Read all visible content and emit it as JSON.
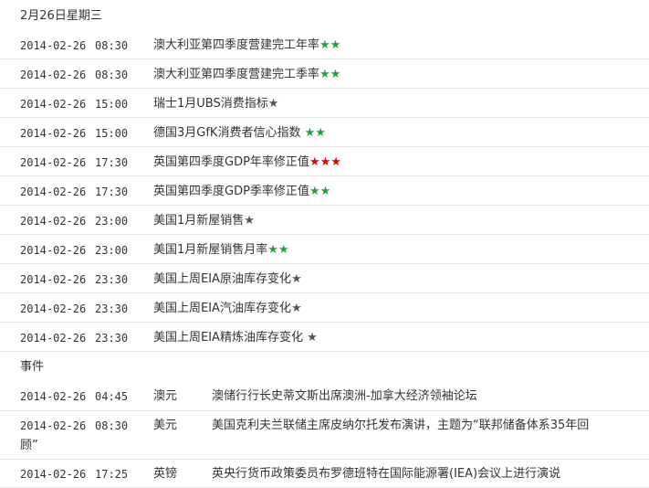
{
  "date_header": "2月26日星期三",
  "economic_data": [
    {
      "date": "2014-02-26",
      "time": "08:30",
      "name": "澳大利亚第四季度营建完工年率",
      "stars": "★★",
      "star_color": "#21a338"
    },
    {
      "date": "2014-02-26",
      "time": "08:30",
      "name": "澳大利亚第四季度营建完工季率",
      "stars": "★★",
      "star_color": "#21a338"
    },
    {
      "date": "2014-02-26",
      "time": "15:00",
      "name": "瑞士1月UBS消费指标",
      "stars": "★",
      "star_color": "#555555"
    },
    {
      "date": "2014-02-26",
      "time": "15:00",
      "name": "德国3月GfK消费者信心指数 ",
      "stars": "★★",
      "star_color": "#21a338"
    },
    {
      "date": "2014-02-26",
      "time": "17:30",
      "name": "英国第四季度GDP年率修正值",
      "stars": "★★★",
      "star_color": "#e60000"
    },
    {
      "date": "2014-02-26",
      "time": "17:30",
      "name": "英国第四季度GDP季率修正值",
      "stars": "★★",
      "star_color": "#21a338"
    },
    {
      "date": "2014-02-26",
      "time": "23:00",
      "name": "美国1月新屋销售",
      "stars": "★",
      "star_color": "#555555"
    },
    {
      "date": "2014-02-26",
      "time": "23:00",
      "name": "美国1月新屋销售月率",
      "stars": "★★",
      "star_color": "#21a338"
    },
    {
      "date": "2014-02-26",
      "time": "23:30",
      "name": "美国上周EIA原油库存变化",
      "stars": "★",
      "star_color": "#555555"
    },
    {
      "date": "2014-02-26",
      "time": "23:30",
      "name": "美国上周EIA汽油库存变化",
      "stars": "★",
      "star_color": "#555555"
    },
    {
      "date": "2014-02-26",
      "time": "23:30",
      "name": "美国上周EIA精炼油库存变化 ",
      "stars": "★",
      "star_color": "#555555"
    }
  ],
  "events_title": "事件",
  "events": [
    {
      "date": "2014-02-26",
      "time": "04:45",
      "currency": "澳元",
      "desc": "澳储行行长史蒂文斯出席澳洲-加拿大经济领袖论坛",
      "desc_wrap": ""
    },
    {
      "date": "2014-02-26",
      "time": "08:30",
      "currency": "美元",
      "desc": "美国克利夫兰联储主席皮纳尔托发布演讲，主题为“联邦储备体系35年回",
      "desc_wrap": "顾”"
    },
    {
      "date": "2014-02-26",
      "time": "17:25",
      "currency": "英镑",
      "desc": "英央行货币政策委员布罗德班特在国际能源署(IEA)会议上进行演说",
      "desc_wrap": ""
    }
  ]
}
